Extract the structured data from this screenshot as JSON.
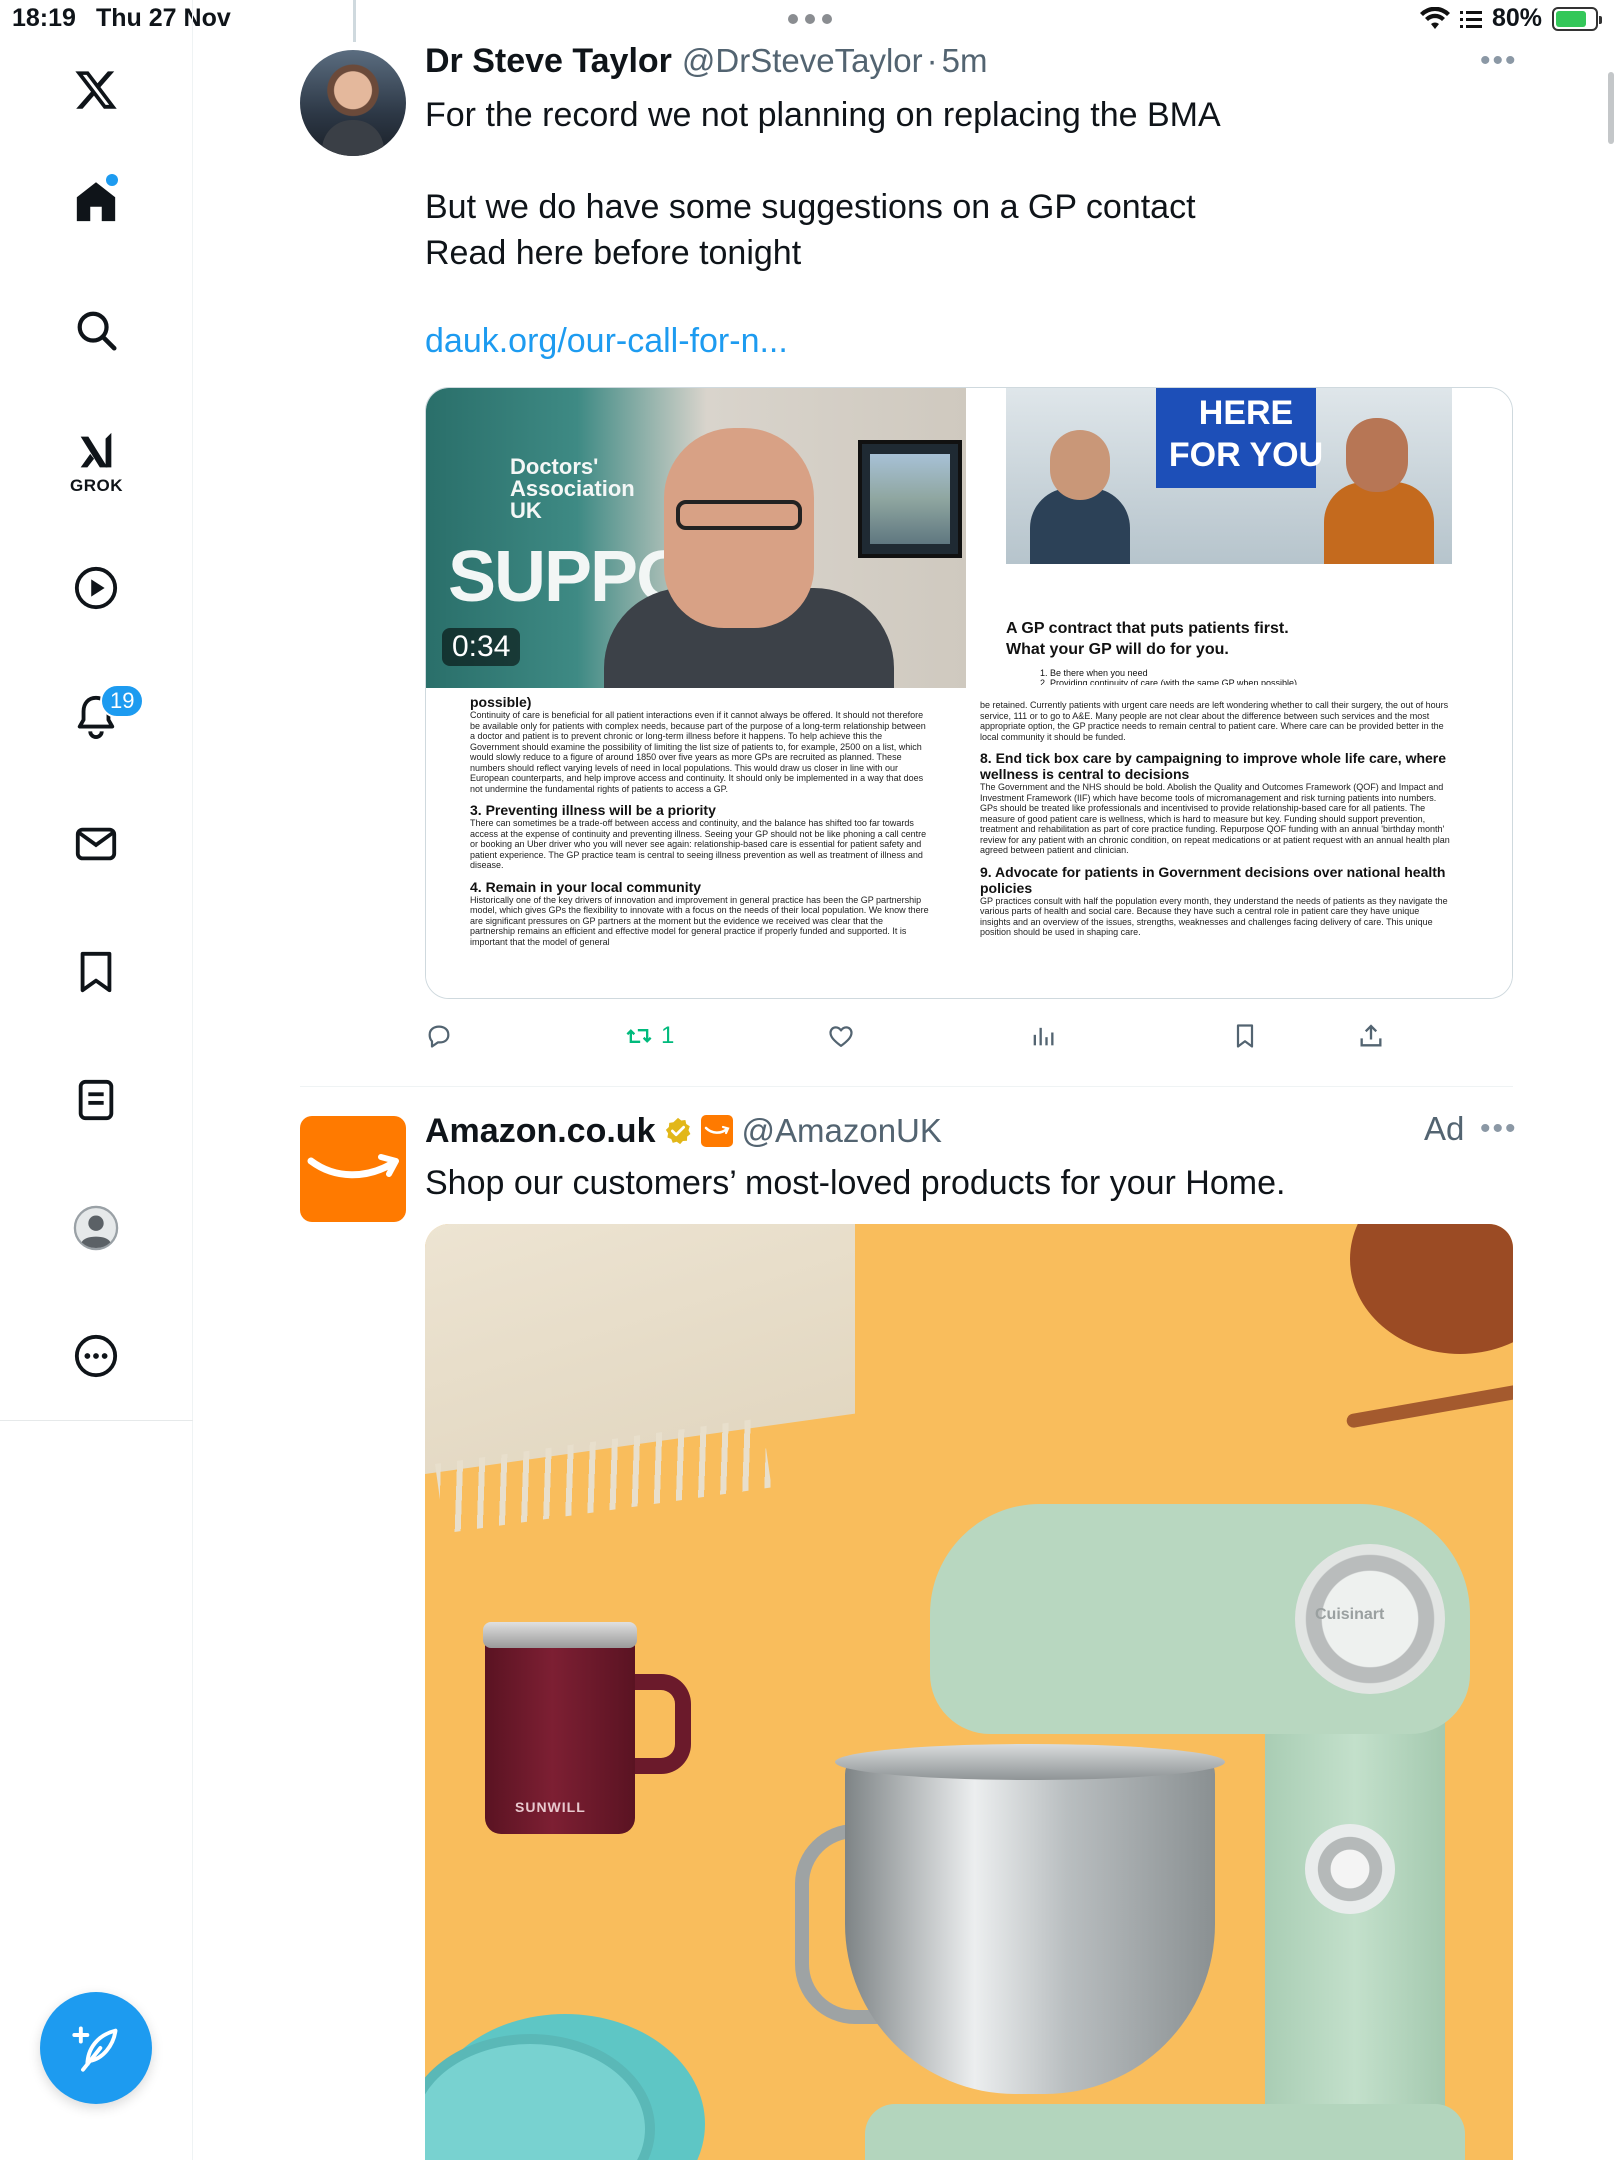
{
  "status_bar": {
    "time": "18:19",
    "date": "Thu 27 Nov",
    "battery": "80%",
    "battery_level": 0.8
  },
  "sidebar": {
    "grok_label": "GROK",
    "notifications_badge": "19",
    "items": [
      {
        "icon": "x-logo-icon"
      },
      {
        "icon": "home-icon"
      },
      {
        "icon": "search-icon"
      },
      {
        "icon": "grok-icon"
      },
      {
        "icon": "video-icon"
      },
      {
        "icon": "bell-icon"
      },
      {
        "icon": "mail-icon"
      },
      {
        "icon": "bookmark-icon"
      },
      {
        "icon": "list-icon"
      },
      {
        "icon": "profile-icon"
      },
      {
        "icon": "more-icon"
      }
    ],
    "compose_icon": "feather-plus-icon"
  },
  "tweets": [
    {
      "name": "Dr Steve Taylor",
      "handle": "@DrSteveTaylor",
      "separator": "·",
      "time": "5m",
      "lines": [
        "For the record we not planning on replacing the BMA",
        "",
        "But we do have some suggestions on a GP contact",
        "Read here before tonight",
        ""
      ],
      "link": "dauk.org/our-call-for-n...",
      "media": {
        "video_duration": "0:34",
        "video_banner_org": "Doctors' Association UK",
        "video_banner_big": "SUPPO",
        "promo_title": "HERE FOR YOU",
        "gp_title_1": "A GP contract that puts patients first.",
        "gp_title_2": "What your GP will do for you.",
        "gp_list_1": "1.    Be there when you need",
        "gp_list_2": "2.    Providing continuity of care (with the same GP when possible)",
        "left_doc": {
          "h0": "possible)",
          "p0": "Continuity of care is beneficial for all patient interactions even if it cannot always be offered. It should not therefore be available only for patients with complex needs, because part of the purpose of a long-term relationship between a doctor and patient is to prevent chronic or long-term illness before it happens. To help achieve this the Government should examine the possibility of limiting the list size of patients to, for example, 2500 on a list, which would slowly reduce to a figure of around 1850 over five years as more GPs are recruited as planned. These numbers should reflect varying levels of need in local populations. This would draw us closer in line with our European counterparts, and help improve access and continuity. It should only be implemented in a way that does not undermine the fundamental rights of patients to access a GP.",
          "h1": "3. Preventing illness will be a priority",
          "p1": "There can sometimes be a trade-off between access and continuity, and the balance has shifted too far towards access at the expense of continuity and preventing illness. Seeing your GP should not be like phoning a call centre or booking an Uber driver who you will never see again: relationship-based care is essential for patient safety and patient experience. The GP practice team is central to seeing illness prevention as well as treatment of illness and disease.",
          "h2": "4. Remain in your local community",
          "p2": "Historically one of the key drivers of innovation and improvement in general practice has been the GP partnership model, which gives GPs the flexibility to innovate with a focus on the needs of their local population. We know there are significant pressures on GP partners at the moment but the evidence we received was clear that the partnership remains an efficient and effective model for general practice if properly funded and supported. It is important that the model of general"
        },
        "right_doc": {
          "p0": "be retained. Currently patients with urgent care needs are left wondering whether to call their surgery, the out of hours service, 111 or to go to A&E. Many people are not clear about the difference between such services and the most appropriate option, the GP practice needs to remain central to patient care. Where care can be provided better in the local community it should be funded.",
          "h1": "8. End tick box care by campaigning to improve whole life care, where wellness is central to decisions",
          "p1": "The Government and the NHS should be bold. Abolish the Quality and Outcomes Framework (QOF) and Impact and Investment Framework (IIF) which have become tools of micromanagement and risk turning patients into numbers. GPs should be treated like professionals and incentivised to provide relationship-based care for all patients. The measure of good patient care is wellness, which is hard to measure but key. Funding should support prevention, treatment and rehabilitation as part of core practice funding. Repurpose QOF funding with an annual 'birthday month' review for any patient with an chronic condition, on repeat medications or at patient request with an annual health plan agreed between patient and clinician.",
          "h2": "9. Advocate for patients in Government decisions over national health policies",
          "p2": "GP practices consult with half the population every month, they understand the needs of patients as they navigate the various parts of health and social care. Because they have such a central role in patient care they have unique insights and an overview of the issues, strengths, weaknesses and challenges facing delivery of care. This unique position should be used in shaping care."
        }
      },
      "actions": {
        "reply_count": "",
        "retweet_count": "1",
        "like_count": "",
        "views_count": ""
      }
    },
    {
      "name": "Amazon.co.uk",
      "handle": "@AmazonUK",
      "ad_label": "Ad",
      "text": "Shop our customers’ most-loved products for your Home.",
      "media": {
        "mug_logo": "SUNWILL",
        "mixer_logo": "Cuisinart"
      }
    }
  ],
  "colors": {
    "accent": "#1d9bf0",
    "retweet": "#00ba7c",
    "amazon_orange": "#ff7a00",
    "ad_background": "#f9bd5c"
  }
}
